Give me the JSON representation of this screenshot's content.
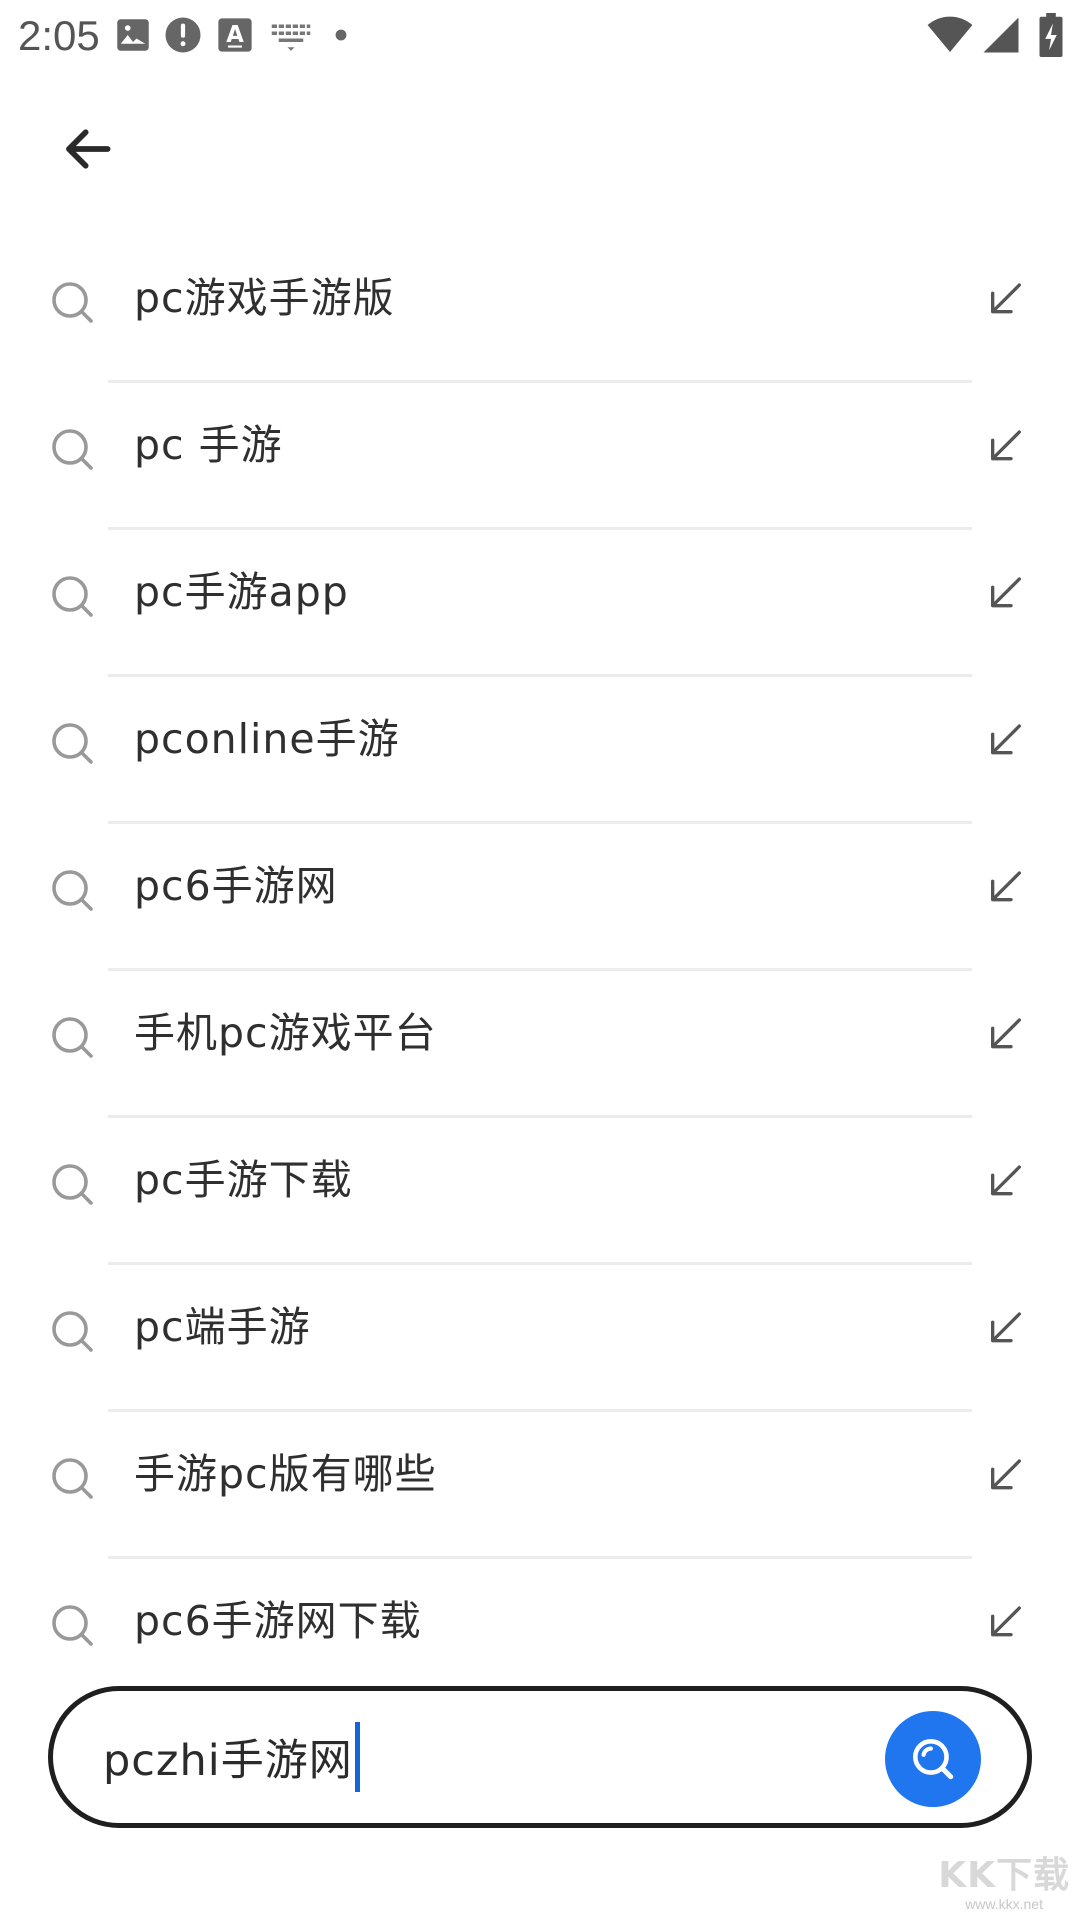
{
  "status_bar": {
    "time": "2:05",
    "icons": [
      "image-icon",
      "alert-icon",
      "text-a-icon",
      "keyboard-icon",
      "dot-icon",
      "wifi-icon",
      "signal-icon",
      "battery-charging-icon"
    ]
  },
  "header": {
    "back_icon": "arrow-left-icon"
  },
  "suggestions": [
    {
      "text": "pc游戏手游版"
    },
    {
      "text": "pc 手游"
    },
    {
      "text": "pc手游app"
    },
    {
      "text": "pconline手游"
    },
    {
      "text": "pc6手游网"
    },
    {
      "text": "手机pc游戏平台"
    },
    {
      "text": "pc手游下载"
    },
    {
      "text": "pc端手游"
    },
    {
      "text": "手游pc版有哪些"
    },
    {
      "text": "pc6手游网下载"
    }
  ],
  "search": {
    "value": "pczhi手游网",
    "button_icon": "search-icon",
    "accent_color": "#1f76ef"
  },
  "watermark": {
    "logo": "KK下载",
    "url": "www.kkx.net"
  }
}
